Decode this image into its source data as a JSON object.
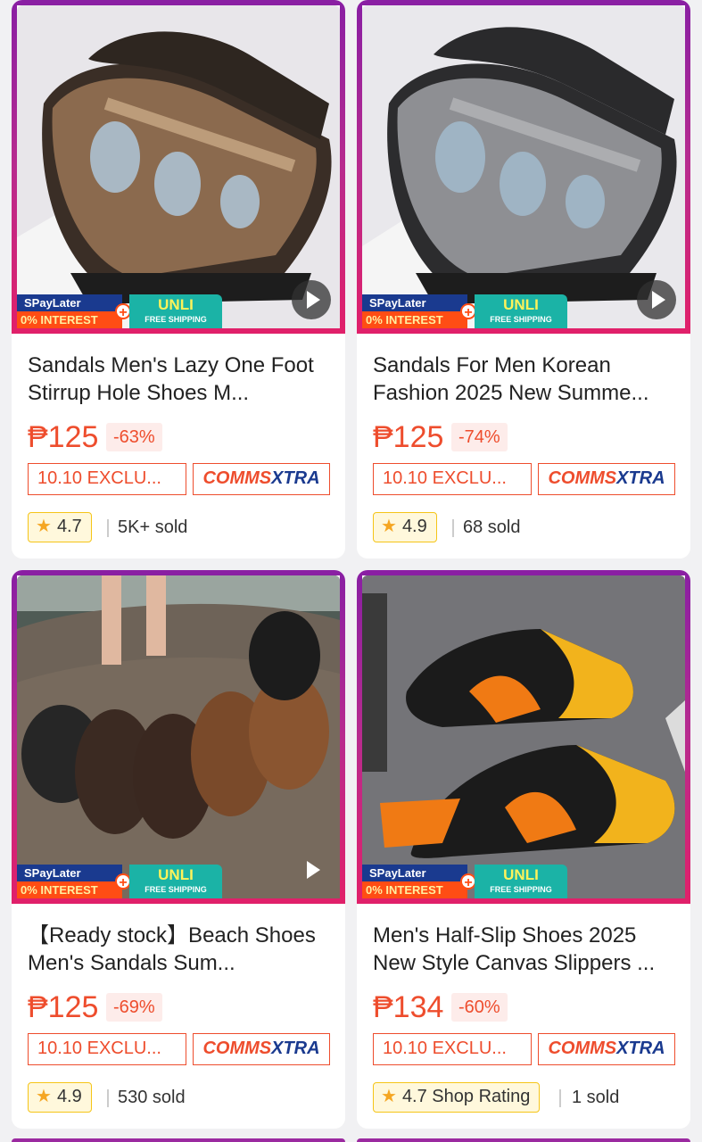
{
  "products": [
    {
      "title": "Sandals Men's Lazy One Foot Stirrup Hole Shoes M...",
      "price": "₱125",
      "discount": "-63%",
      "promo_tag": "10.10 EXCLU...",
      "rating": "4.7",
      "sold": "5K+ sold",
      "has_video": true,
      "image_desc": "brown-mesh-sandals"
    },
    {
      "title": "Sandals For Men Korean Fashion 2025 New Summe...",
      "price": "₱125",
      "discount": "-74%",
      "promo_tag": "10.10 EXCLU...",
      "rating": "4.9",
      "sold": "68 sold",
      "has_video": true,
      "image_desc": "gray-mesh-sandals"
    },
    {
      "title": "【Ready stock】Beach Shoes Men's Sandals Sum...",
      "price": "₱125",
      "discount": "-69%",
      "promo_tag": "10.10 EXCLU...",
      "rating": "4.9",
      "sold": "530 sold",
      "has_video": true,
      "image_desc": "leather-beach-sandals"
    },
    {
      "title": "Men's Half-Slip Shoes 2025 New Style Canvas Slippers ...",
      "price": "₱134",
      "discount": "-60%",
      "promo_tag": "10.10 EXCLU...",
      "rating": "4.7 Shop Rating",
      "sold": "1 sold",
      "has_video": false,
      "image_desc": "orange-canvas-half-slippers"
    }
  ],
  "badges": {
    "spaylater": "SPayLater",
    "interest": "0% INTEREST",
    "unli": "UNLI",
    "free_shipping": "FREE SHIPPING",
    "comms_a": "COMMS",
    "comms_b": "XTRA"
  },
  "colors": {
    "accent": "#ee4d2d",
    "frame": "#9b2aa0",
    "rating_bg": "#fff8dc"
  }
}
